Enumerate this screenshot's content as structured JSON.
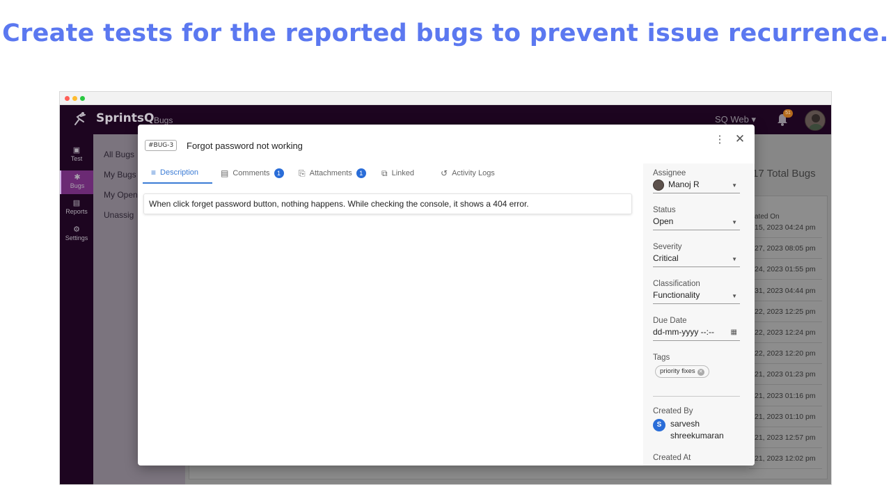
{
  "headline": "Create tests for the reported bugs to prevent issue recurrence.",
  "app": {
    "brand": "SprintsQ",
    "section": "Bugs",
    "project": "SQ Web",
    "notification_count": "51"
  },
  "sidenav": [
    {
      "label": "Test",
      "icon": "test-icon"
    },
    {
      "label": "Bugs",
      "icon": "bug-icon"
    },
    {
      "label": "Reports",
      "icon": "reports-icon"
    },
    {
      "label": "Settings",
      "icon": "settings-icon"
    }
  ],
  "subnav": [
    "All Bugs",
    "My Bugs",
    "My Open",
    "Unassig"
  ],
  "list": {
    "total": "17 Total Bugs",
    "col_created": "ated On",
    "dates": [
      "15, 2023 04:24 pm",
      "27, 2023 08:05 pm",
      "24, 2023 01:55 pm",
      "31, 2023 04:44 pm",
      "22, 2023 12:25 pm",
      "22, 2023 12:24 pm",
      "22, 2023 12:20 pm",
      "21, 2023 01:23 pm",
      "21, 2023 01:16 pm",
      "21, 2023 01:10 pm",
      "21, 2023 12:57 pm",
      "21, 2023 12:02 pm"
    ]
  },
  "modal": {
    "bug_id": "#BUG-3",
    "title": "Forgot password not working",
    "tabs": [
      {
        "label": "Description",
        "badge": ""
      },
      {
        "label": "Comments",
        "badge": "1"
      },
      {
        "label": "Attachments",
        "badge": "1"
      },
      {
        "label": "Linked",
        "badge": ""
      },
      {
        "label": "Activity Logs",
        "badge": ""
      }
    ],
    "description": "When click forget password button, nothing happens. While checking the console, it shows a 404 error.",
    "fields": {
      "assignee_label": "Assignee",
      "assignee_value": "Manoj R",
      "status_label": "Status",
      "status_value": "Open",
      "severity_label": "Severity",
      "severity_value": "Critical",
      "classification_label": "Classification",
      "classification_value": "Functionality",
      "due_label": "Due Date",
      "due_placeholder": "dd-mm-yyyy --:--",
      "tags_label": "Tags",
      "tag": "priority fixes",
      "created_by_label": "Created By",
      "creator_initial": "S",
      "creator_first": "sarvesh",
      "creator_last": "shreekumaran",
      "created_at_label": "Created At"
    }
  }
}
